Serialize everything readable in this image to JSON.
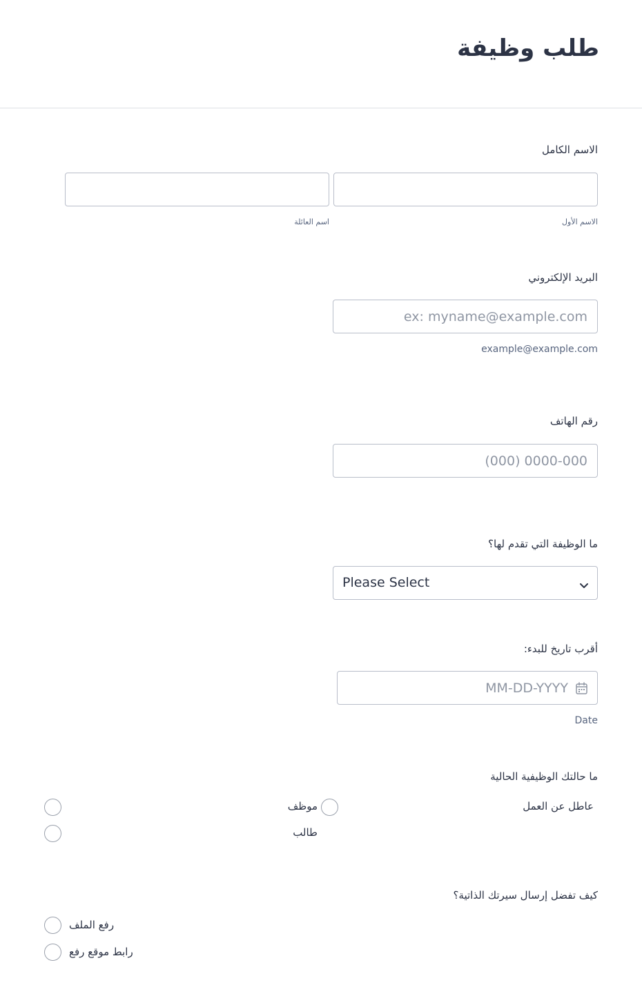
{
  "form": {
    "title": "طلب وظيفة"
  },
  "full_name": {
    "label": "الاسم الكامل",
    "first": {
      "value": "",
      "sublabel": "الاسم الأول"
    },
    "last": {
      "value": "",
      "sublabel": "اسم العائلة"
    }
  },
  "email": {
    "label": "البريد الإلكتروني",
    "value": "",
    "placeholder": "ex: myname@example.com",
    "hint": "example@example.com"
  },
  "phone": {
    "label": "رقم الهاتف",
    "value": "",
    "placeholder": "(000) 0000-000"
  },
  "position": {
    "label": "ما الوظيفة التي تقدم لها؟",
    "selected": "Please Select",
    "icon": "chevron-down-icon"
  },
  "start_date": {
    "label": "أقرب تاريخ للبدء:",
    "value": "",
    "placeholder": "MM-DD-YYYY",
    "hint": "Date",
    "icon": "calendar-icon"
  },
  "employment_status": {
    "label": "ما حالتك الوظيفية الحالية",
    "options": [
      "عاطل عن العمل",
      "موظف",
      "طالب"
    ]
  },
  "resume_method": {
    "label": "كيف تفضل إرسال سيرتك الذاتية؟",
    "options": [
      "رفع الملف",
      "رابط موقع رفع"
    ]
  },
  "colors": {
    "text": "#2c3345",
    "muted": "#57647e",
    "border": "#b8bdc9",
    "placeholder": "#8f96a3"
  }
}
